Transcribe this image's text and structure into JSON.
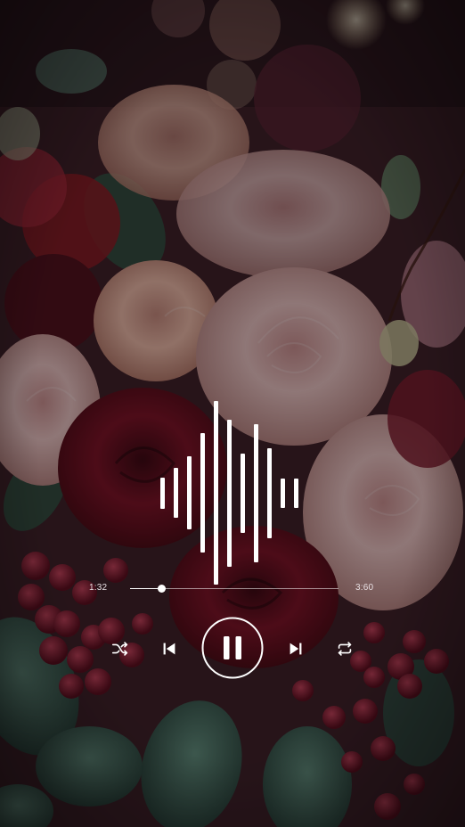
{
  "player": {
    "elapsed": "1:32",
    "duration": "3:60",
    "progress": 0.15,
    "is_playing": true
  },
  "waveform": {
    "levels": [
      0.17,
      0.27,
      0.4,
      0.65,
      1.0,
      0.8,
      0.43,
      0.75,
      0.49,
      0.16,
      0.16
    ]
  },
  "controls": [
    {
      "id": "shuffle",
      "icon": "shuffle-icon"
    },
    {
      "id": "previous",
      "icon": "skip-previous-icon"
    },
    {
      "id": "play-pause",
      "icon": "pause-icon"
    },
    {
      "id": "next",
      "icon": "skip-next-icon"
    },
    {
      "id": "repeat",
      "icon": "repeat-icon"
    }
  ],
  "colors": {
    "foreground": "#ffffff",
    "overlay": "#0a0608"
  }
}
